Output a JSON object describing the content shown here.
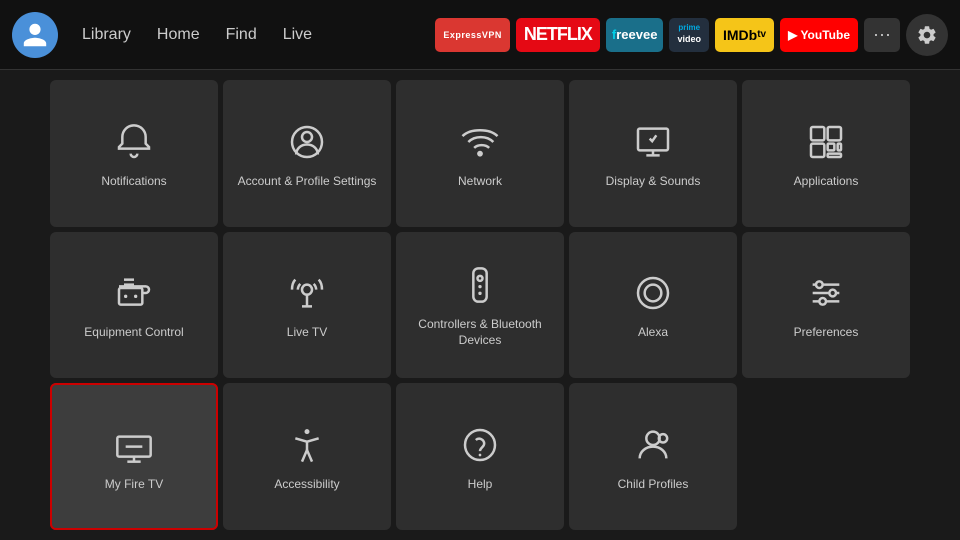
{
  "nav": {
    "links": [
      "Library",
      "Home",
      "Find",
      "Live"
    ],
    "apps": [
      {
        "name": "ExpressVPN",
        "class": "app-expressvpn",
        "label": "ExpressVPN"
      },
      {
        "name": "Netflix",
        "class": "app-netflix",
        "label": "NETFLIX"
      },
      {
        "name": "Freevee",
        "class": "app-freevee",
        "label": "freevee"
      },
      {
        "name": "Prime Video",
        "class": "app-prime",
        "label": "prime\nvideo"
      },
      {
        "name": "IMDb TV",
        "class": "app-imdb",
        "label": "IMDb tv"
      },
      {
        "name": "YouTube",
        "class": "app-youtube",
        "label": "▶ YouTube"
      }
    ],
    "more_label": "•••",
    "settings_label": "⚙"
  },
  "tiles": [
    {
      "id": "notifications",
      "label": "Notifications",
      "icon": "bell",
      "focused": false
    },
    {
      "id": "account-profile",
      "label": "Account & Profile Settings",
      "icon": "person-circle",
      "focused": false
    },
    {
      "id": "network",
      "label": "Network",
      "icon": "wifi",
      "focused": false
    },
    {
      "id": "display-sounds",
      "label": "Display & Sounds",
      "icon": "display-sound",
      "focused": false
    },
    {
      "id": "applications",
      "label": "Applications",
      "icon": "apps",
      "focused": false
    },
    {
      "id": "equipment-control",
      "label": "Equipment Control",
      "icon": "tv-remote",
      "focused": false
    },
    {
      "id": "live-tv",
      "label": "Live TV",
      "icon": "antenna",
      "focused": false
    },
    {
      "id": "controllers-bluetooth",
      "label": "Controllers & Bluetooth Devices",
      "icon": "remote",
      "focused": false
    },
    {
      "id": "alexa",
      "label": "Alexa",
      "icon": "alexa",
      "focused": false
    },
    {
      "id": "preferences",
      "label": "Preferences",
      "icon": "sliders",
      "focused": false
    },
    {
      "id": "my-fire-tv",
      "label": "My Fire TV",
      "icon": "fire-tv",
      "focused": true
    },
    {
      "id": "accessibility",
      "label": "Accessibility",
      "icon": "accessibility",
      "focused": false
    },
    {
      "id": "help",
      "label": "Help",
      "icon": "help",
      "focused": false
    },
    {
      "id": "child-profiles",
      "label": "Child Profiles",
      "icon": "child-profiles",
      "focused": false
    }
  ]
}
